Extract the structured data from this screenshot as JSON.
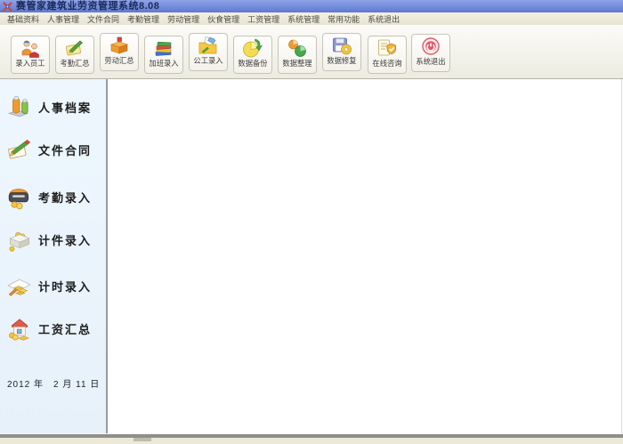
{
  "window": {
    "title": "赛管家建筑业劳资管理系统8.08",
    "app_icon": "app-logo-icon"
  },
  "menu": {
    "items": [
      "基础资料",
      "人事管理",
      "文件合同",
      "考勤管理",
      "劳动管理",
      "伙食管理",
      "工资管理",
      "系统管理",
      "常用功能",
      "系统退出"
    ]
  },
  "toolbar": {
    "buttons": [
      {
        "label": "录入员工",
        "icon": "two-workers-icon"
      },
      {
        "label": "考勤汇总",
        "icon": "notepad-pen-icon"
      },
      {
        "label": "劳动汇总",
        "icon": "orange-box-icon"
      },
      {
        "label": "加班录入",
        "icon": "stacked-books-icon"
      },
      {
        "label": "公工录入",
        "icon": "folder-pencil-icon"
      },
      {
        "label": "数据备份",
        "icon": "pie-disk-arrow-icon"
      },
      {
        "label": "数据整理",
        "icon": "charts-icon"
      },
      {
        "label": "数据修复",
        "icon": "floppy-disk-icon"
      },
      {
        "label": "在线咨询",
        "icon": "notepad-shield-icon"
      },
      {
        "label": "系统退出",
        "icon": "red-seal-icon"
      }
    ]
  },
  "sidebar": {
    "items": [
      {
        "label": "人事档案",
        "icon": "two-figures-icon"
      },
      {
        "label": "文件合同",
        "icon": "contract-pen-icon"
      },
      {
        "label": "考勤录入",
        "icon": "punch-machine-icon"
      },
      {
        "label": "计件录入",
        "icon": "box-coins-icon"
      },
      {
        "label": "计时录入",
        "icon": "sheet-goldbars-icon"
      },
      {
        "label": "工资汇总",
        "icon": "house-gold-icon"
      }
    ],
    "date_label": "2012 年　2 月 11 日"
  },
  "colors": {
    "titlebar_top": "#8ea4e6",
    "titlebar_bottom": "#5f78cc",
    "menubar_bg": "#eceadb",
    "toolbar_bg": "#f2f0e6",
    "sidebar_bg": "#ecf5fd",
    "statusbar_gray": "#8f8f89",
    "statusbar_beige": "#ece9d8"
  }
}
